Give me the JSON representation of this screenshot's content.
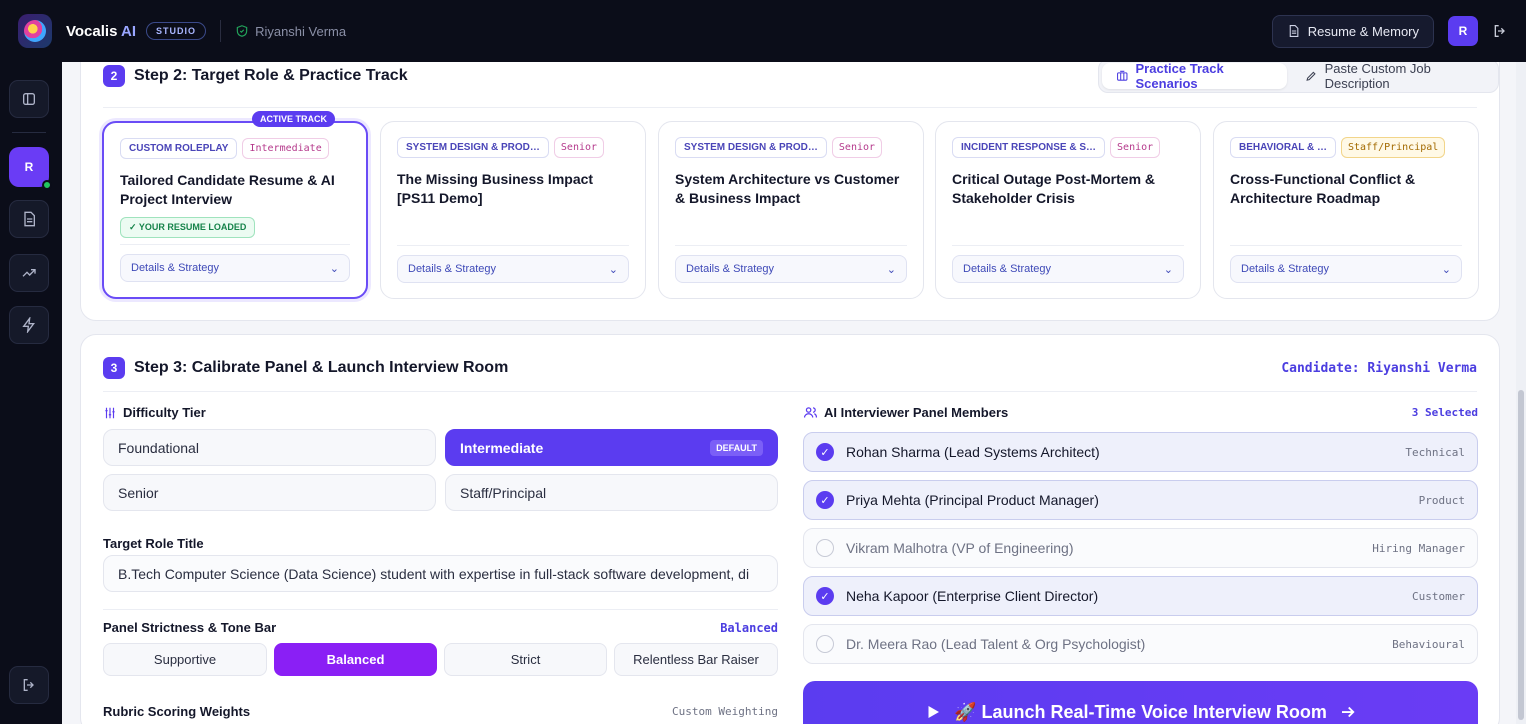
{
  "app": {
    "brand": "Vocalis",
    "brand_ai": "AI",
    "badge": "STUDIO",
    "user": "Riyanshi Verma",
    "resume_button": "Resume & Memory",
    "avatar": "R"
  },
  "sidebar": {
    "avatar": "R"
  },
  "step2": {
    "num": "2",
    "title": "Step 2: Target Role & Practice Track",
    "tab_scenarios": "Practice Track Scenarios",
    "tab_custom": "Paste Custom Job Description",
    "tracks": [
      {
        "category": "CUSTOM ROLEPLAY",
        "level": "Intermediate",
        "title": "Tailored Candidate Resume & AI Project Interview",
        "badge": "ACTIVE TRACK",
        "resume": "✓ YOUR RESUME LOADED",
        "details": "Details & Strategy"
      },
      {
        "category": "SYSTEM DESIGN & PROD…",
        "level": "Senior",
        "title": "The Missing Business Impact [PS11 Demo]",
        "details": "Details & Strategy"
      },
      {
        "category": "SYSTEM DESIGN & PROD…",
        "level": "Senior",
        "title": "System Architecture vs Customer & Business Impact",
        "details": "Details & Strategy"
      },
      {
        "category": "INCIDENT RESPONSE & S…",
        "level": "Senior",
        "title": "Critical Outage Post-Mortem & Stakeholder Crisis",
        "details": "Details & Strategy"
      },
      {
        "category": "BEHAVIORAL & …",
        "level": "Staff/Principal",
        "title": "Cross-Functional Conflict & Architecture Roadmap",
        "details": "Details & Strategy"
      }
    ]
  },
  "step3": {
    "num": "3",
    "title": "Step 3: Calibrate Panel & Launch Interview Room",
    "candidate": "Candidate: Riyanshi Verma",
    "difficulty_label": "Difficulty Tier",
    "difficulty": [
      "Foundational",
      "Intermediate",
      "Senior",
      "Staff/Principal"
    ],
    "difficulty_default": "DEFAULT",
    "role_label": "Target Role Title",
    "role_value": "B.Tech Computer Science (Data Science) student with expertise in full-stack software development, di",
    "tone_label": "Panel Strictness & Tone Bar",
    "tone_value": "Balanced",
    "tone": [
      "Supportive",
      "Balanced",
      "Strict",
      "Relentless Bar Raiser"
    ],
    "rubric_label": "Rubric Scoring Weights",
    "rubric_mode": "Custom Weighting",
    "panel_label": "AI Interviewer Panel Members",
    "panel_count": "3 Selected",
    "members": [
      {
        "name": "Rohan Sharma (Lead Systems Architect)",
        "role": "Technical"
      },
      {
        "name": "Priya Mehta (Principal Product Manager)",
        "role": "Product"
      },
      {
        "name": "Vikram Malhotra (VP of Engineering)",
        "role": "Hiring Manager"
      },
      {
        "name": "Neha Kapoor (Enterprise Client Director)",
        "role": "Customer"
      },
      {
        "name": "Dr. Meera Rao (Lead Talent & Org Psychologist)",
        "role": "Behavioural"
      }
    ],
    "launch": "🚀 Launch Real-Time Voice Interview Room"
  }
}
